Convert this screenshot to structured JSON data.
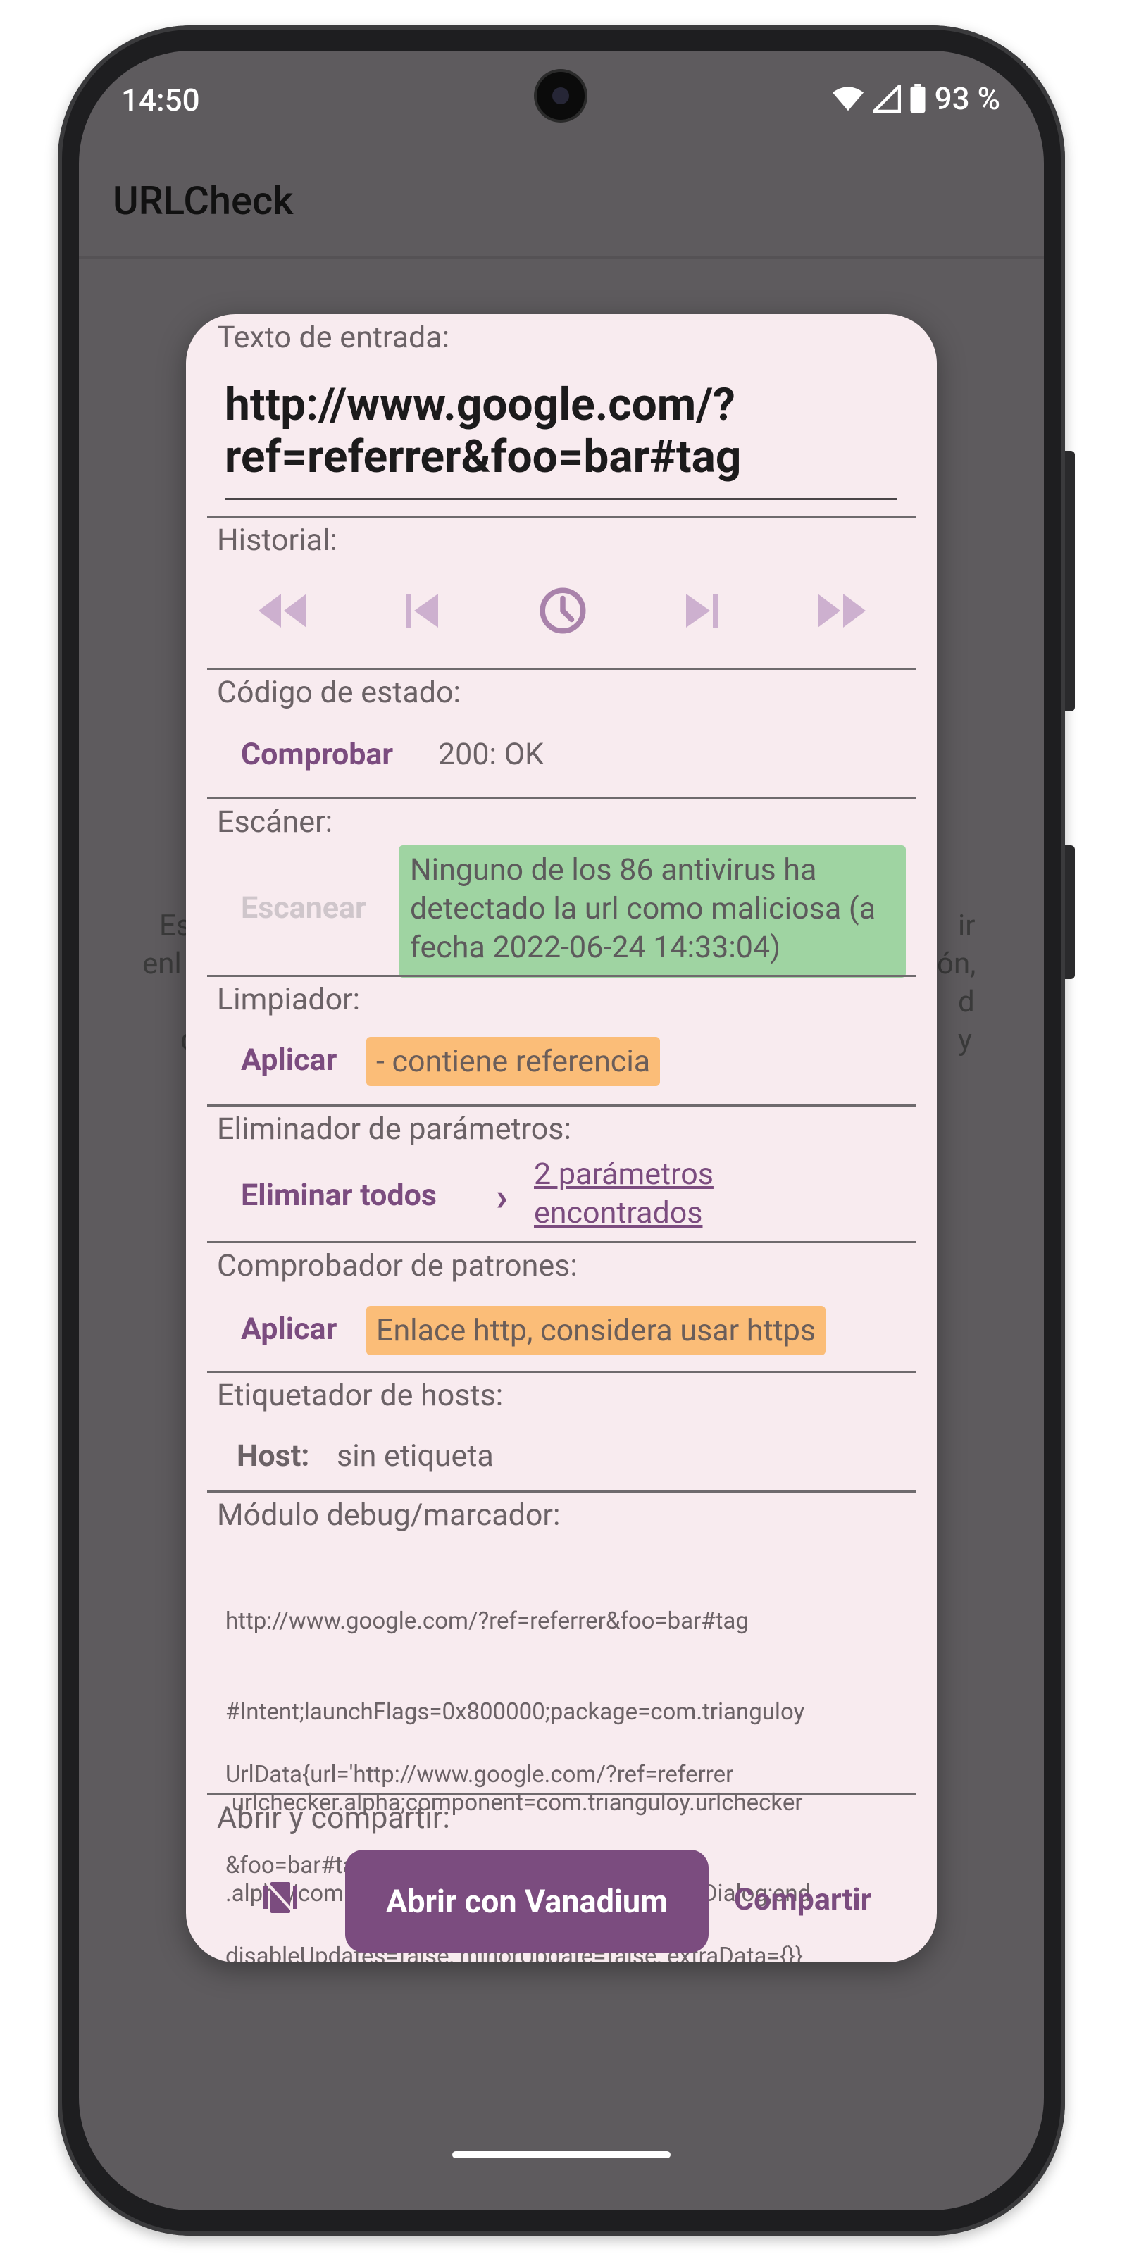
{
  "status_bar": {
    "time": "14:50",
    "battery": "93 %"
  },
  "app_bar": {
    "title": "URLCheck"
  },
  "background_text": {
    "left_1": "Es",
    "left_2": "enl",
    "left_3": "s",
    "left_4": "c",
    "right_1": "ir",
    "right_2": "ón,",
    "right_3": "d",
    "right_4": "y"
  },
  "dialog": {
    "input": {
      "label": "Texto de entrada:",
      "value": "http://www.google.com/?ref=referrer&foo=bar#tag"
    },
    "history": {
      "label": "Historial:"
    },
    "status_code": {
      "label": "Código de estado:",
      "button": "Comprobar",
      "result": "200: OK"
    },
    "scanner": {
      "label": "Escáner:",
      "button": "Escanear",
      "result": "Ninguno de los 86 antivirus ha detectado la url como maliciosa (a fecha 2022-06-24 14:33:04)"
    },
    "cleaner": {
      "label": "Limpiador:",
      "button": "Aplicar",
      "result": "- contiene referencia"
    },
    "param_remover": {
      "label": "Eliminador de parámetros:",
      "button": "Eliminar todos",
      "expander": "›",
      "link": "2 parámetros encontrados"
    },
    "pattern_checker": {
      "label": "Comprobador de patrones:",
      "button": "Aplicar",
      "result": "Enlace http, considera usar https"
    },
    "host_labeler": {
      "label": "Etiquetador de hosts:",
      "host_key": "Host:",
      "host_value": "sin etiqueta"
    },
    "debug": {
      "label": "Módulo debug/marcador:",
      "intent_lines": [
        "http://www.google.com/?ref=referrer&foo=bar#tag",
        "#Intent;launchFlags=0x800000;package=com.trianguloy",
        ".urlchecker.alpha;component=com.trianguloy.urlchecker",
        ".alpha/com.trianguloy.urlchecker.dialogs.MainDialog;end"
      ],
      "data_lines": [
        "UrlData{url='http://www.google.com/?ref=referrer",
        "&foo=bar#tag', trigger=null, triggerOwn=true,",
        "disableUpdates=false, minorUpdate=false, extraData={}}"
      ]
    },
    "open_share": {
      "label": "Abrir y compartir:",
      "open_button": "Abrir con Vanadium",
      "share_button": "Compartir"
    }
  },
  "colors": {
    "accent": "#7b4c7f",
    "dialog_bg": "#f8ebef",
    "scrim": "#5e5b5e",
    "success_chip": "#9fd4a2",
    "warning_chip": "#fbbd78"
  }
}
